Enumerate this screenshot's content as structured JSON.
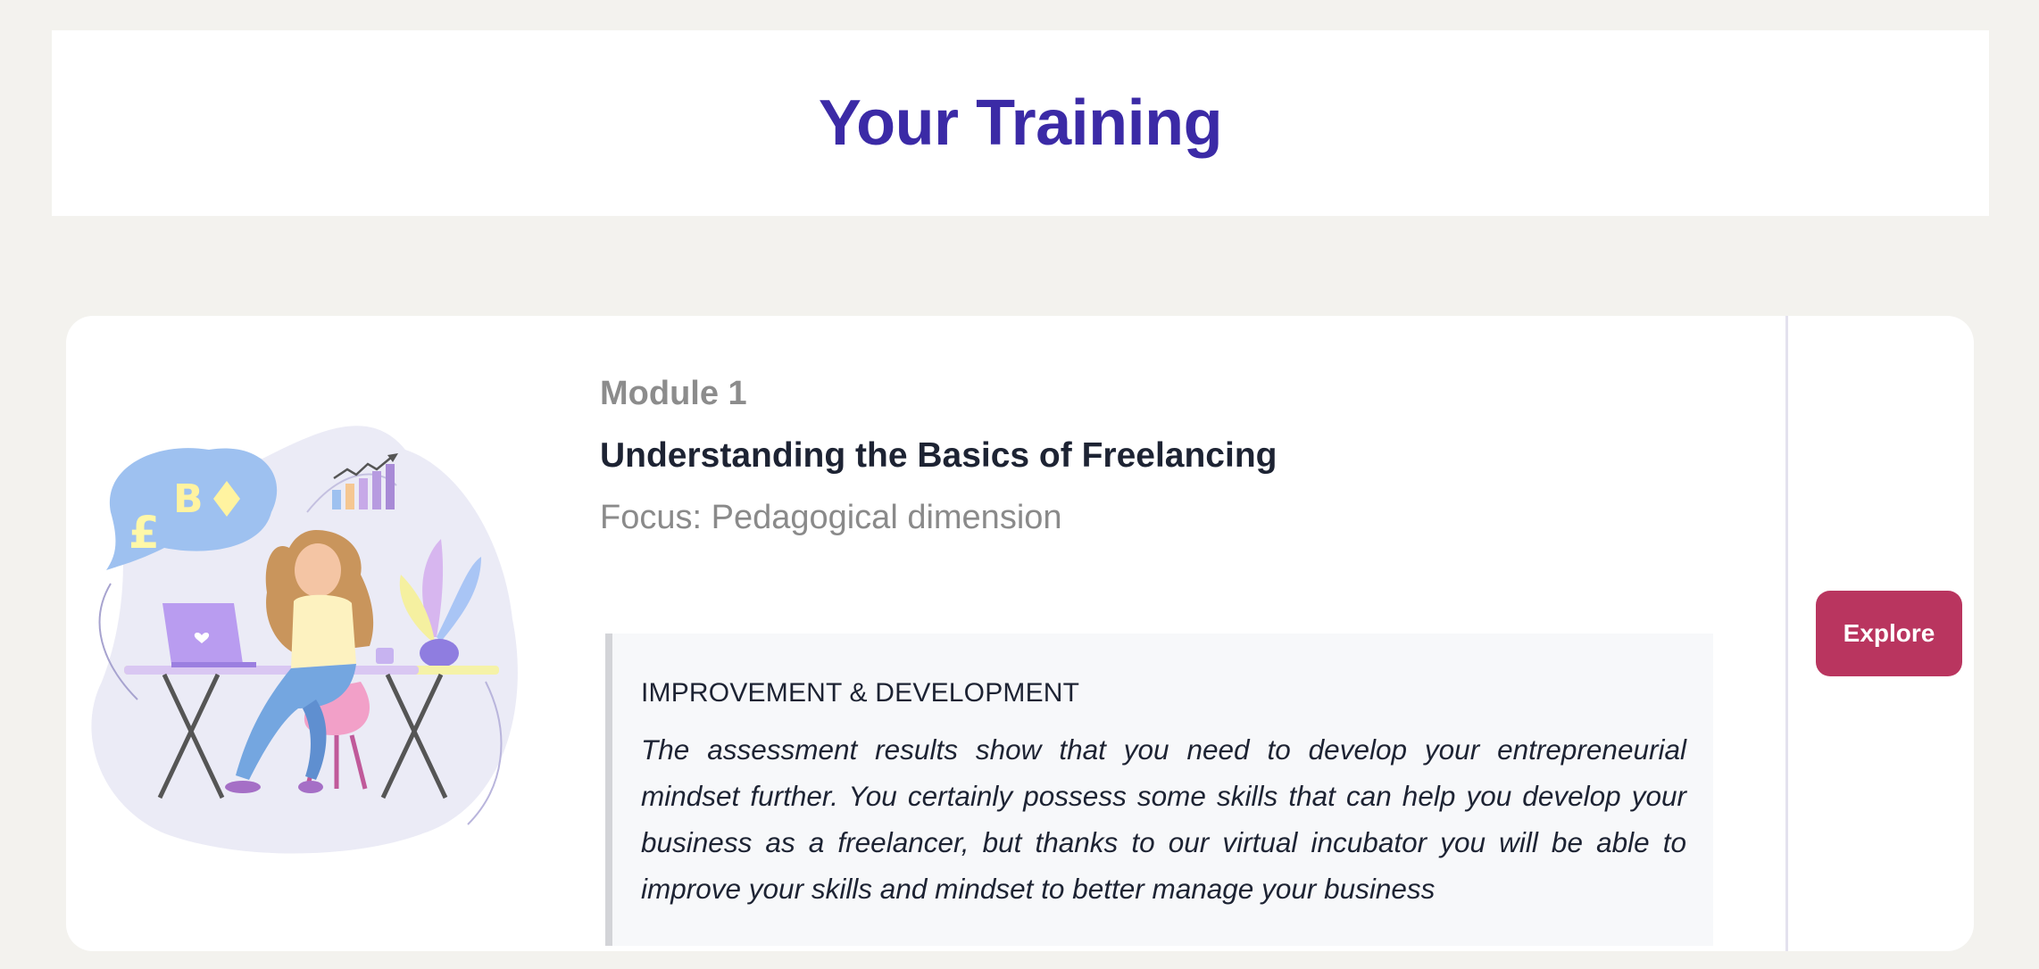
{
  "page": {
    "title": "Your Training"
  },
  "module": {
    "label": "Module 1",
    "title": "Understanding the Basics of Freelancing",
    "focus": "Focus: Pedagogical dimension",
    "feedback": {
      "heading": "IMPROVEMENT & DEVELOPMENT",
      "text": "The assessment results show that you need to develop your entrepreneurial mindset further. You certainly possess some skills that can help you develop your business as a freelancer, but thanks to our virtual incubator you will be able to improve your skills and mindset to better manage your business"
    },
    "action_label": "Explore",
    "illustration_icon": "freelancer-at-desk-illustration"
  },
  "colors": {
    "background": "#f3f2ee",
    "title": "#3b2aa6",
    "accent_button": "#b9355f",
    "text_dark": "#1d2333",
    "text_muted": "#8c8c8c"
  }
}
